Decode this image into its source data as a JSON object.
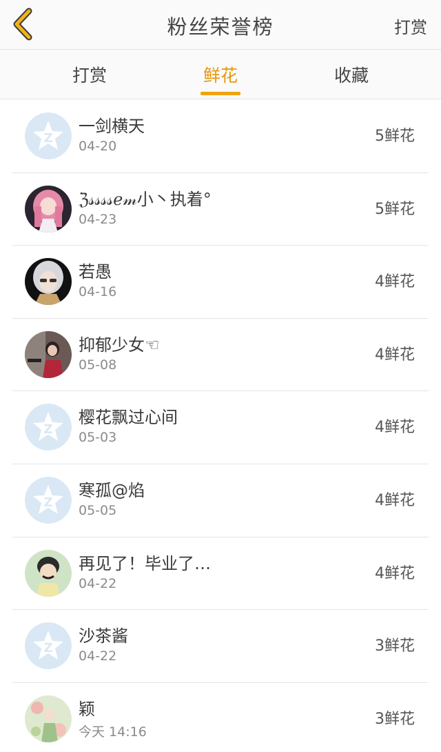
{
  "header": {
    "title": "粉丝荣誉榜",
    "right_link": "打赏"
  },
  "tabs": [
    {
      "label": "打赏"
    },
    {
      "label": "鲜花"
    },
    {
      "label": "收藏"
    }
  ],
  "list": [
    {
      "name": "一剑横天",
      "date": "04-20",
      "count": "5鲜花",
      "avatar": "default-z-avatar"
    },
    {
      "name": "ℨ𝓈𝓈𝓈𝓈ℯ𝓂小丶执着°",
      "date": "04-23",
      "count": "5鲜花",
      "avatar": "pink-hair-girl-avatar"
    },
    {
      "name": "若愚",
      "date": "04-16",
      "count": "4鲜花",
      "avatar": "silver-hair-avatar"
    },
    {
      "name": "抑郁少女☜",
      "date": "05-08",
      "count": "4鲜花",
      "avatar": "photo-girl-avatar"
    },
    {
      "name": "樱花飘过心间",
      "date": "05-03",
      "count": "4鲜花",
      "avatar": "default-z-avatar"
    },
    {
      "name": "寒孤@焰",
      "date": "05-05",
      "count": "4鲜花",
      "avatar": "default-z-avatar"
    },
    {
      "name": "再见了！毕业了…",
      "date": "04-22",
      "count": "4鲜花",
      "avatar": "cartoon-boy-avatar"
    },
    {
      "name": "沙茶酱",
      "date": "04-22",
      "count": "3鲜花",
      "avatar": "default-z-avatar"
    },
    {
      "name": "颖",
      "date": "今天 14:16",
      "count": "3鲜花",
      "avatar": "flower-girl-avatar"
    }
  ],
  "colors": {
    "accent": "#f0a20f",
    "back_icon": "#f2b21a",
    "default_avatar_bg": "#d9e8f4"
  }
}
